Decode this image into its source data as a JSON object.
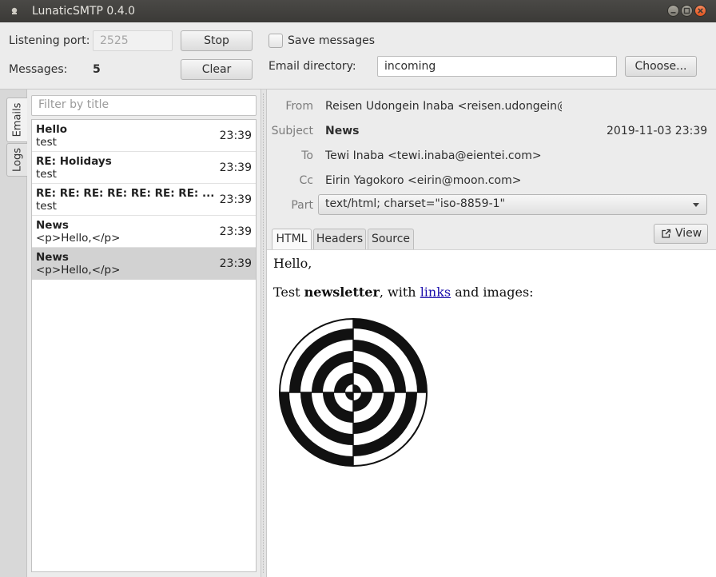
{
  "window": {
    "title": "LunaticSMTP 0.4.0"
  },
  "top": {
    "port_label": "Listening port:",
    "port_value": "2525",
    "stop_label": "Stop",
    "messages_label": "Messages:",
    "messages_count": "5",
    "clear_label": "Clear",
    "save_label": "Save messages",
    "save_checked": false,
    "dir_label": "Email directory:",
    "dir_value": "incoming",
    "choose_label": "Choose..."
  },
  "side_tabs": [
    {
      "label": "Emails",
      "active": true
    },
    {
      "label": "Logs",
      "active": false
    }
  ],
  "list": {
    "filter_placeholder": "Filter by title",
    "items": [
      {
        "title": "Hello",
        "preview": "test",
        "time": "23:39"
      },
      {
        "title": "RE: Holidays",
        "preview": "test",
        "time": "23:39"
      },
      {
        "title": "RE: RE: RE: RE: RE: RE: RE: ...",
        "preview": "test",
        "time": "23:39"
      },
      {
        "title": "News",
        "preview": "<p>Hello,</p>",
        "time": "23:39"
      },
      {
        "title": "News",
        "preview": "<p>Hello,</p>",
        "time": "23:39",
        "selected": true
      }
    ]
  },
  "detail": {
    "from_label": "From",
    "from_value": "Reisen Udongein Inaba <reisen.udongein@m",
    "subject_label": "Subject",
    "subject_value": "News",
    "date_value": "2019-11-03 23:39",
    "to_label": "To",
    "to_value": "Tewi Inaba <tewi.inaba@eientei.com>",
    "cc_label": "Cc",
    "cc_value": "Eirin Yagokoro <eirin@moon.com>",
    "part_label": "Part",
    "part_value": "text/html; charset=\"iso-8859-1\"",
    "tabs": [
      "HTML",
      "Headers",
      "Source"
    ],
    "active_tab": "HTML",
    "view_label": "View"
  },
  "message": {
    "line1": "Hello,",
    "line2_pre": "Test ",
    "line2_bold": "newsletter",
    "line2_mid": ", with ",
    "line2_link": "links",
    "line2_post": " and images:"
  }
}
